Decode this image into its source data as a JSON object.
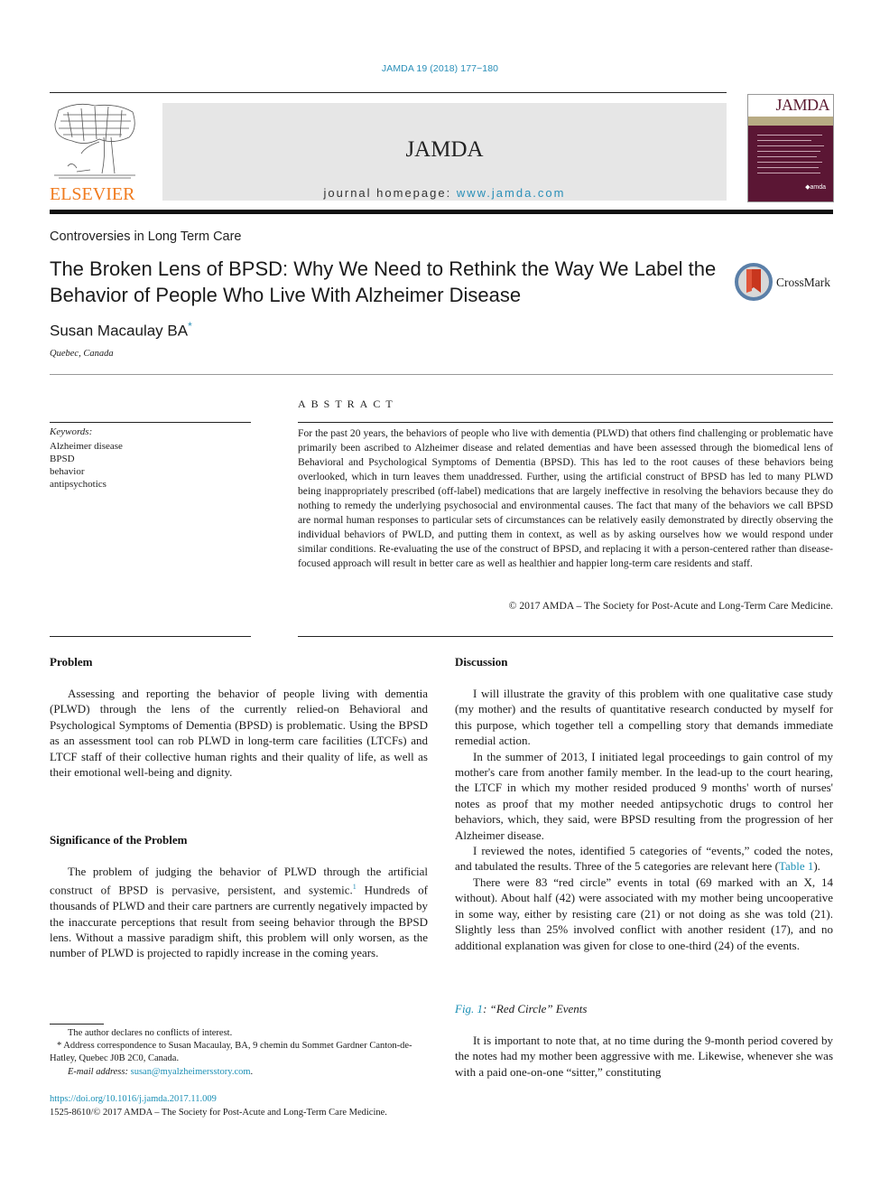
{
  "header": {
    "journal_ref": "JAMDA 19 (2018) 177−180",
    "journal_name": "JAMDA",
    "homepage_prefix": "journal homepage: ",
    "homepage_url": "www.jamda.com",
    "publisher": "ELSEVIER",
    "cover_title": "JAMDA",
    "cover_logo": "◆amda",
    "brand_colors": {
      "link": "#2a8fb8",
      "elsevier": "#f07b1e",
      "cover": "#5b1634"
    }
  },
  "article": {
    "section": "Controversies in Long Term Care",
    "title": "The Broken Lens of BPSD: Why We Need to Rethink the Way We Label the Behavior of People Who Live With Alzheimer Disease",
    "crossmark_label": "CrossMark",
    "author": "Susan Macaulay BA",
    "author_mark": "*",
    "affiliation": "Quebec, Canada"
  },
  "abstract": {
    "heading": "ABSTRACT",
    "text": "For the past 20 years, the behaviors of people who live with dementia (PLWD) that others find challenging or problematic have primarily been ascribed to Alzheimer disease and related dementias and have been assessed through the biomedical lens of Behavioral and Psychological Symptoms of Dementia (BPSD). This has led to the root causes of these behaviors being overlooked, which in turn leaves them unaddressed. Further, using the artificial construct of BPSD has led to many PLWD being inappropriately prescribed (off-label) medications that are largely ineffective in resolving the behaviors because they do nothing to remedy the underlying psychosocial and environmental causes. The fact that many of the behaviors we call BPSD are normal human responses to particular sets of circumstances can be relatively easily demonstrated by directly observing the individual behaviors of PWLD, and putting them in context, as well as by asking ourselves how we would respond under similar conditions. Re-evaluating the use of the construct of BPSD, and replacing it with a person-centered rather than disease-focused approach will result in better care as well as healthier and happier long-term care residents and staff.",
    "copyright": "© 2017 AMDA – The Society for Post-Acute and Long-Term Care Medicine."
  },
  "keywords": {
    "heading": "Keywords:",
    "items": [
      "Alzheimer disease",
      "BPSD",
      "behavior",
      "antipsychotics"
    ]
  },
  "body": {
    "problem_heading": "Problem",
    "problem_text": "Assessing and reporting the behavior of people living with dementia (PLWD) through the lens of the currently relied-on Behavioral and Psychological Symptoms of Dementia (BPSD) is problematic. Using the BPSD as an assessment tool can rob PLWD in long-term care facilities (LTCFs) and LTCF staff of their collective human rights and their quality of life, as well as their emotional well-being and dignity.",
    "significance_heading": "Significance of the Problem",
    "significance_text": "The problem of judging the behavior of PLWD through the artificial construct of BPSD is pervasive, persistent, and systemic.",
    "significance_ref": "1",
    "significance_text2": " Hundreds of thousands of PLWD and their care partners are currently negatively impacted by the inaccurate perceptions that result from seeing behavior through the BPSD lens. Without a massive paradigm shift, this problem will only worsen, as the number of PLWD is projected to rapidly increase in the coming years.",
    "discussion_heading": "Discussion",
    "discussion_p1": "I will illustrate the gravity of this problem with one qualitative case study (my mother) and the results of quantitative research conducted by myself for this purpose, which together tell a compelling story that demands immediate remedial action.",
    "discussion_p2": "In the summer of 2013, I initiated legal proceedings to gain control of my mother's care from another family member. In the lead-up to the court hearing, the LTCF in which my mother resided produced 9 months' worth of nurses' notes as proof that my mother needed antipsychotic drugs to control her behaviors, which, they said, were BPSD resulting from the progression of her Alzheimer disease.",
    "discussion_p3a": "I reviewed the notes, identified 5 categories of “events,” coded the notes, and tabulated the results. Three of the 5 categories are relevant here (",
    "discussion_p3_link": "Table 1",
    "discussion_p3b": ").",
    "discussion_p4": "There were 83 “red circle” events in total (69 marked with an X, 14 without). About half (42) were associated with my mother being uncooperative in some way, either by resisting care (21) or not doing as she was told (21). Slightly less than 25% involved conflict with another resident (17), and no additional explanation was given for close to one-third (24) of the events.",
    "fig_link": "Fig. 1",
    "fig_caption": ": “Red Circle” Events",
    "discussion_p5": "It is important to note that, at no time during the 9-month period covered by the notes had my mother been aggressive with me. Likewise, whenever she was with a paid one-on-one “sitter,” constituting"
  },
  "footnotes": {
    "conflict": "The author declares no conflicts of interest.",
    "address": "* Address correspondence to Susan Macaulay, BA, 9 chemin du Sommet Gardner Canton-de-Hatley, Quebec J0B 2C0, Canada.",
    "email_label": "E-mail address: ",
    "email": "susan@myalzheimersstory.com",
    "email_end": ".",
    "doi": "https://doi.org/10.1016/j.jamda.2017.11.009",
    "issn": "1525-8610/© 2017 AMDA – The Society for Post-Acute and Long-Term Care Medicine."
  }
}
